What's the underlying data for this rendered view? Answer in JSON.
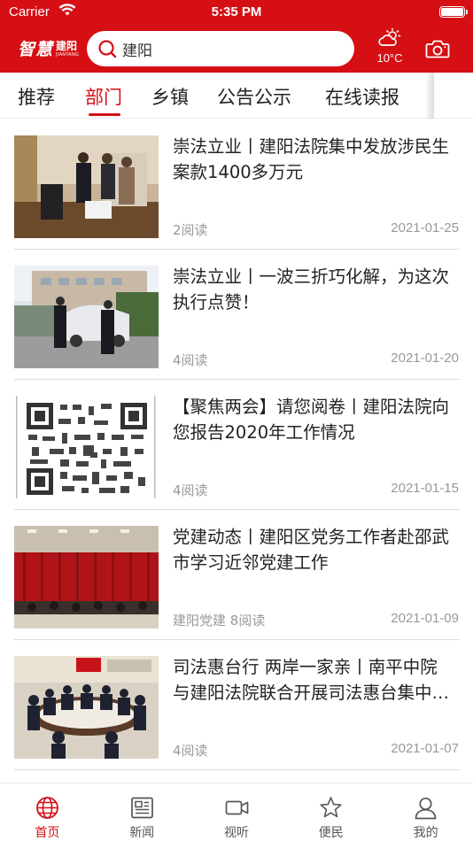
{
  "status_bar": {
    "carrier": "Carrier",
    "time": "5:35 PM"
  },
  "header": {
    "logo_main": "智慧",
    "logo_city": "建阳",
    "logo_pinyin": "JIANYANG",
    "search_value": "建阳",
    "weather_temp": "10°C",
    "icons": {
      "weather": "partly-cloudy-icon",
      "camera": "camera-icon",
      "search": "search-icon"
    }
  },
  "tabs": [
    {
      "label": "推荐",
      "active": false
    },
    {
      "label": "部门",
      "active": true
    },
    {
      "label": "乡镇",
      "active": false
    },
    {
      "label": "公告公示",
      "active": false
    },
    {
      "label": "在线读报",
      "active": false
    }
  ],
  "news": [
    {
      "title": "崇法立业丨建阳法院集中发放涉民生案款1400多万元",
      "source": "",
      "reads": "2阅读",
      "date": "2021-01-25"
    },
    {
      "title": "崇法立业丨一波三折巧化解，为这次执行点赞！",
      "source": "",
      "reads": "4阅读",
      "date": "2021-01-20"
    },
    {
      "title": "【聚焦两会】请您阅卷丨建阳法院向您报告2020年工作情况",
      "source": "",
      "reads": "4阅读",
      "date": "2021-01-15"
    },
    {
      "title": "党建动态丨建阳区党务工作者赴邵武市学习近邻党建工作",
      "source": "建阳党建",
      "reads": "8阅读",
      "date": "2021-01-09"
    },
    {
      "title": "司法惠台行 两岸一家亲丨南平中院与建阳法院联合开展司法惠台集中宣传活动",
      "source": "",
      "reads": "4阅读",
      "date": "2021-01-07"
    }
  ],
  "bottom_nav": [
    {
      "label": "首页",
      "icon": "globe-icon",
      "active": true
    },
    {
      "label": "新闻",
      "icon": "newspaper-icon",
      "active": false
    },
    {
      "label": "视听",
      "icon": "video-icon",
      "active": false
    },
    {
      "label": "便民",
      "icon": "star-icon",
      "active": false
    },
    {
      "label": "我的",
      "icon": "user-icon",
      "active": false
    }
  ],
  "colors": {
    "brand_red": "#d50f14",
    "meta_gray": "#999999"
  }
}
